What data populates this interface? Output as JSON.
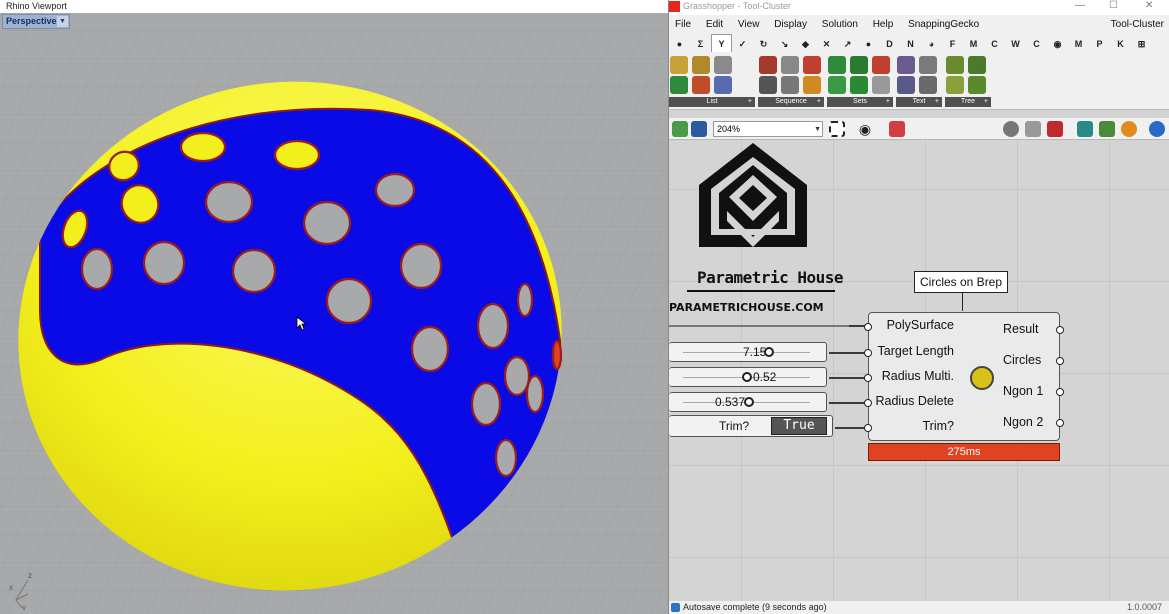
{
  "rhino": {
    "window_title": "Rhino Viewport",
    "viewport_tab": "Perspective",
    "axis_labels": {
      "x": "x",
      "y": "y",
      "z": "z"
    },
    "colors": {
      "background": "#a7a9ab",
      "sphere": "#f2ef1a",
      "pattern": "#0a0ae6",
      "hole_edge": "#9b1c1c"
    }
  },
  "gh": {
    "window_title": "Grasshopper - Tool-Cluster",
    "window_controls": [
      "—",
      "☐",
      "✕"
    ],
    "menu": [
      "File",
      "Edit",
      "View",
      "Display",
      "Solution",
      "Help",
      "SnappingGecko"
    ],
    "document_name": "Tool-Cluster",
    "category_tabs": [
      "●",
      "Σ",
      "Y",
      "✓",
      "↻",
      "↘",
      "◆",
      "✕",
      "↗",
      "●",
      "D",
      "N",
      "◕",
      "F",
      "M",
      "C",
      "W",
      "C",
      "◉",
      "M",
      "P",
      "K",
      "⊞"
    ],
    "panels": [
      {
        "label": "List",
        "color": "#c7a238"
      },
      {
        "label": "Sequence",
        "color": "#a43a2c"
      },
      {
        "label": "Sets",
        "color": "#2f8a3a"
      },
      {
        "label": "Text",
        "color": "#6b5a8e"
      },
      {
        "label": "Tree",
        "color": "#6a8a2e"
      }
    ],
    "zoom": "204%",
    "brand": {
      "title": "Parametric House",
      "url": "PARAMETRICHOUSE.COM"
    },
    "component": {
      "name": "Circles on Brep",
      "inputs": [
        "PolySurface",
        "Target Length",
        "Radius Multi.",
        "Radius Delete",
        "Trim?"
      ],
      "outputs": [
        "Result",
        "Circles",
        "Ngon 1",
        "Ngon 2"
      ],
      "time": "275ms",
      "time_color": "#e0431f"
    },
    "sliders": [
      {
        "value": "7.15",
        "level": 0.72
      },
      {
        "value": "0.52",
        "level": 0.52
      },
      {
        "value": "0.537",
        "level": 0.537
      }
    ],
    "toggle": {
      "label": "Trim?",
      "value": "True"
    },
    "status": {
      "text": "Autosave complete (9 seconds ago)",
      "version": "1.0.0007"
    }
  }
}
